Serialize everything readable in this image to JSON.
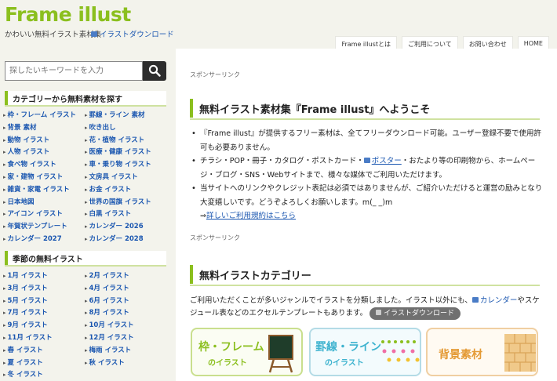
{
  "header": {
    "logo": "Frame illust",
    "tagline": "かわいい無料イラスト素材集",
    "download_link": "イラストダウンロード",
    "nav": [
      "Frame illustとは",
      "ご利用について",
      "お問い合わせ",
      "HOME"
    ]
  },
  "sidebar": {
    "search_placeholder": "探したいキーワードを入力",
    "section1_title": "カテゴリーから無料素材を探す",
    "categories": [
      "枠・フレーム イラスト",
      "罫線・ライン 素材",
      "背景 素材",
      "吹き出し",
      "動物 イラスト",
      "花・植物 イラスト",
      "人物 イラスト",
      "医療・健康 イラスト",
      "食べ物 イラスト",
      "車・乗り物 イラスト",
      "家・建物 イラスト",
      "文房具 イラスト",
      "雑貨・家電 イラスト",
      "お金 イラスト",
      "日本地図",
      "世界の国旗 イラスト",
      "アイコン イラスト",
      "白黒 イラスト",
      "年賀状テンプレート",
      "カレンダー 2026",
      "カレンダー 2027",
      "カレンダー 2028"
    ],
    "section2_title": "季節の無料イラスト",
    "seasons": [
      "1月 イラスト",
      "2月 イラスト",
      "3月 イラスト",
      "4月 イラスト",
      "5月 イラスト",
      "6月 イラスト",
      "7月 イラスト",
      "8月 イラスト",
      "9月 イラスト",
      "10月 イラスト",
      "11月 イラスト",
      "12月 イラスト",
      "春 イラスト",
      "梅雨 イラスト",
      "夏 イラスト",
      "秋 イラスト",
      "冬 イラスト"
    ]
  },
  "main": {
    "sponsor": "スポンサーリンク",
    "welcome_title": "無料イラスト素材集『Frame illust』へようこそ",
    "bullet1": "『Frame illust』が提供するフリー素材は、全てフリーダウンロード可能。ユーザー登録不要で使用許可も必要ありません。",
    "bullet2_pre": "チラシ・POP・冊子・カタログ・ポストカード・",
    "bullet2_link": "ポスター",
    "bullet2_post": "・おたより等の印刷物から、ホームページ・ブログ・SNS・Webサイトまで、様々な媒体でご利用いただけます。",
    "bullet3": "当サイトへのリンクやクレジット表記は必須ではありませんが、ご紹介いただけると運営の励みとなり大変嬉しいです。どうぞよろしくお願いします。m(_ _)m",
    "terms_arrow": "⇒",
    "terms_link": "詳しいご利用規約はこちら",
    "sponsor2": "スポンサーリンク",
    "categories_title": "無料イラストカテゴリー",
    "intro_pre": "ご利用いただくことが多いジャンルでイラストを分類しました。イラスト以外にも、",
    "intro_link": "カレンダー",
    "intro_post": "やスケジュール表などのエクセルテンプレートもあります。",
    "pill": "イラストダウンロード",
    "cards": [
      {
        "title": "枠・フレーム",
        "sub": "のイラスト",
        "color": "#8bbf1e"
      },
      {
        "title": "罫線・ライン",
        "sub": "のイラスト",
        "color": "#3eb3cf"
      },
      {
        "title": "背景素材",
        "sub": "",
        "color": "#e49a35"
      }
    ]
  }
}
